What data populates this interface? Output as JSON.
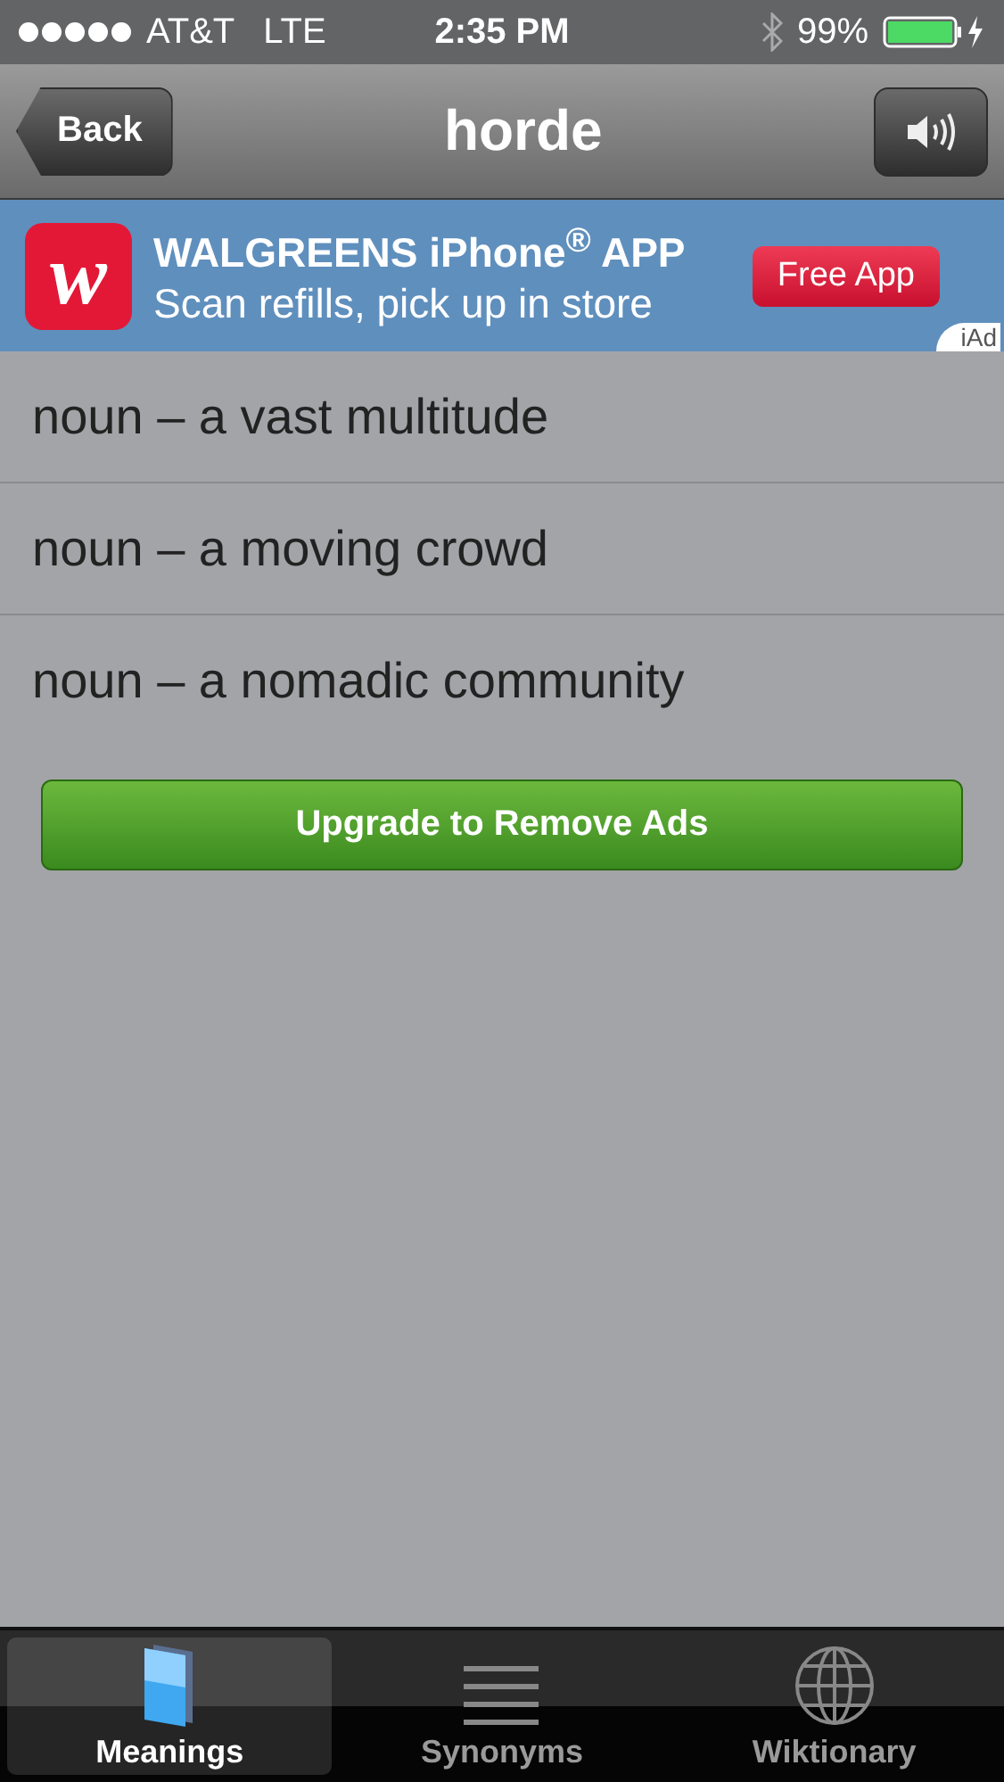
{
  "status_bar": {
    "carrier": "AT&T",
    "network": "LTE",
    "time": "2:35 PM",
    "battery": "99%"
  },
  "nav": {
    "back": "Back",
    "title": "horde"
  },
  "ad": {
    "logo": "w",
    "headline": "WALGREENS iPhone$^{®}$ APP",
    "subline": "Scan refills, pick up in store",
    "cta": "Free App",
    "badge": "iAd"
  },
  "meanings": [
    {
      "text": "noun – a vast multitude"
    },
    {
      "text": "noun – a moving crowd"
    },
    {
      "text": "noun – a nomadic community"
    }
  ],
  "upgrade_button": "Upgrade to Remove Ads",
  "tabs": [
    {
      "label": "Meanings",
      "kind": "book",
      "selected": true
    },
    {
      "label": "Synonyms",
      "kind": "lines",
      "selected": false
    },
    {
      "label": "Wiktionary",
      "kind": "globe",
      "selected": false
    }
  ]
}
